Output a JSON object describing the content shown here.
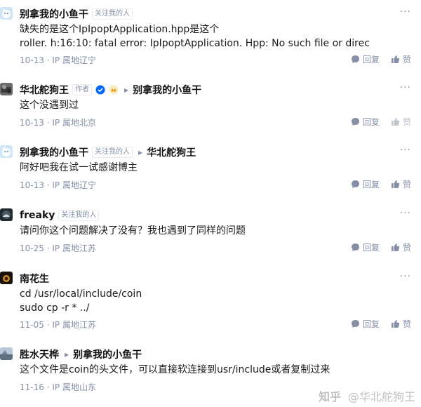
{
  "comments": [
    {
      "author": "别拿我的小鱼干",
      "badge": "关注我的人",
      "body_lines": [
        "缺失的是这个IpIpoptApplication.hpp是这个",
        "roller. h:16:10: fatal error: IpIpoptApplication. Hpp: No such file or direc"
      ],
      "date": "10-13",
      "location": "IP 属地辽宁",
      "reply_label": "回复",
      "like_label": "赞"
    },
    {
      "author": "华北舵狗王",
      "author_tag": "作者",
      "reply_to": "别拿我的小鱼干",
      "body_lines": [
        "这个没遇到过"
      ],
      "date": "10-13",
      "location": "IP 属地北京",
      "reply_label": "回复",
      "like_label": "赞"
    },
    {
      "author": "别拿我的小鱼干",
      "badge": "关注我的人",
      "reply_to": "华北舵狗王",
      "body_lines": [
        "阿好吧我在试一试感谢博主"
      ],
      "date": "10-13",
      "location": "IP 属地辽宁",
      "reply_label": "回复",
      "like_label": "赞"
    },
    {
      "author": "freaky",
      "badge": "关注我的人",
      "body_lines": [
        "请问你这个问题解决了没有？我也遇到了同样的问题"
      ],
      "date": "10-25",
      "location": "IP 属地江苏",
      "reply_label": "回复",
      "like_label": "赞"
    },
    {
      "author": "南花生",
      "body_lines": [
        "cd /usr/local/include/coin",
        "sudo cp -r * ../"
      ],
      "date": "11-05",
      "location": "IP 属地江苏",
      "reply_label": "回复",
      "like_label": "赞"
    },
    {
      "author": "胜水天桦",
      "reply_to": "别拿我的小鱼干",
      "body_lines": [
        "这个文件是coin的头文件，可以直接软连接到usr/include或者复制过来"
      ],
      "date": "11-16",
      "location": "IP 属地山东",
      "reply_label": "回复",
      "like_label": "赞"
    }
  ],
  "meta_separator": "·",
  "watermark": {
    "logo": "知乎",
    "handle": "@华北舵狗王"
  },
  "colors": {
    "muted": "#8590a6",
    "text": "#1a1a1a",
    "verify_blue": "#0066ff",
    "crown_gold": "#e8a317"
  }
}
